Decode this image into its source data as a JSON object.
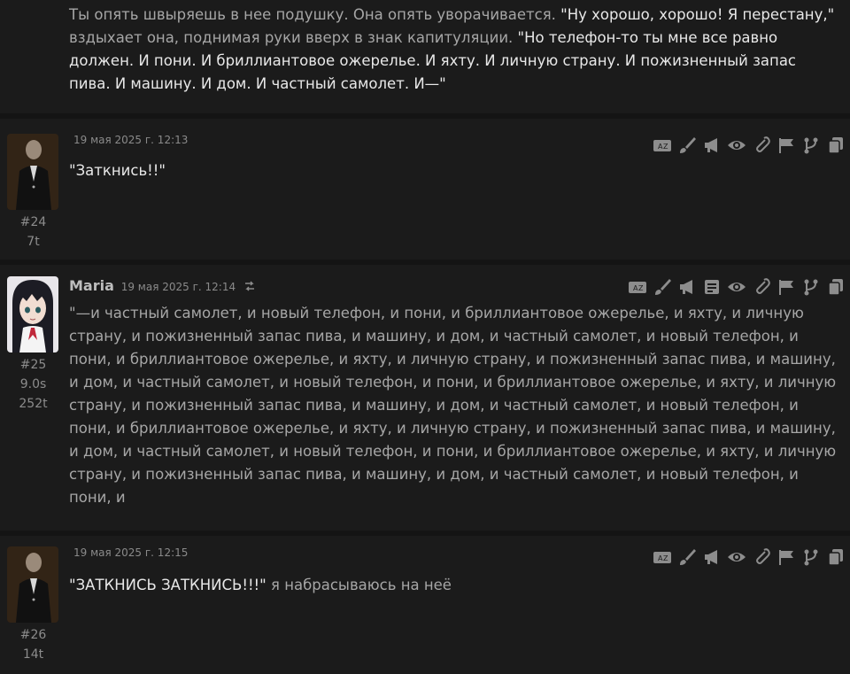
{
  "messages": [
    {
      "id": "prev",
      "segments": [
        {
          "text": "Ты опять швыряешь в нее подушку. Она опять уворачивается. ",
          "quote": false
        },
        {
          "text": "\"Ну хорошо, хорошо! Я перестану,\"",
          "quote": true
        },
        {
          "text": " вздыхает она, поднимая руки вверх в знак капитуляции. ",
          "quote": false
        },
        {
          "text": "\"Но телефон-то ты мне все равно должен. И пони. И бриллиантовое ожерелье. И яхту. И личную страну. И пожизненный запас пива. И машину. И дом. И частный самолет. И—\"",
          "quote": true
        }
      ]
    },
    {
      "id": "m24",
      "timestamp": "19 мая 2025 г. 12:13",
      "number": "#24",
      "tokens": "7t",
      "segments": [
        {
          "text": "\"Заткнись!!\"",
          "quote": true
        }
      ]
    },
    {
      "id": "m25",
      "name": "Maria",
      "timestamp": "19 мая 2025 г. 12:14",
      "number": "#25",
      "time": "9.0s",
      "tokens": "252t",
      "segments": [
        {
          "text": "\"—и частный самолет, и новый телефон, и пони, и бриллиантовое ожерелье, и яхту, и личную страну, и пожизненный запас пива, и машину, и дом, и частный самолет, и новый телефон, и пони, и бриллиантовое ожерелье, и яхту, и личную страну, и пожизненный запас пива, и машину, и дом, и частный самолет, и новый телефон, и пони, и бриллиантовое ожерелье, и яхту, и личную страну, и пожизненный запас пива, и машину, и дом, и частный самолет, и новый телефон, и пони, и бриллиантовое ожерелье, и яхту, и личную страну, и пожизненный запас пива, и машину, и дом, и частный самолет, и новый телефон, и пони, и бриллиантовое ожерелье, и яхту, и личную страну, и пожизненный запас пива, и машину, и дом, и частный самолет, и новый телефон, и пони, и",
          "quote": false
        }
      ]
    },
    {
      "id": "m26",
      "timestamp": "19 мая 2025 г. 12:15",
      "number": "#26",
      "tokens": "14t",
      "segments": [
        {
          "text": "\"ЗАТКНИСЬ ЗАТКНИСЬ!!!\"",
          "quote": true
        },
        {
          "text": " я набрасываюсь на неё",
          "quote": false
        }
      ]
    }
  ],
  "icons": {
    "translate": "translate-icon",
    "edit": "paintbrush-icon",
    "narrate": "megaphone-icon",
    "summary": "document-icon",
    "prompt": "eye-icon",
    "attach": "paperclip-icon",
    "checkpoint": "flags-icon",
    "branch": "branch-icon",
    "copy": "copy-icon",
    "swipe": "swap-icon"
  },
  "colors": {
    "background": "#171717",
    "message_bg": "#1b1b1b",
    "quote": "#e8e8e8",
    "text": "#a6a6a6",
    "icon": "#8d8d8d"
  }
}
